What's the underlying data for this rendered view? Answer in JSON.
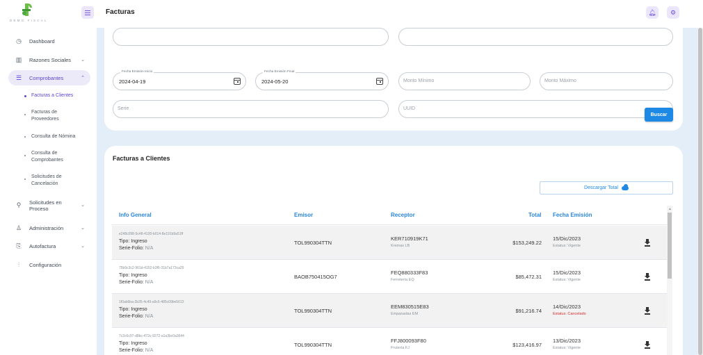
{
  "brand": {
    "wordmark": "DEMO FISCAL"
  },
  "header": {
    "title": "Facturas"
  },
  "sidebar": {
    "items": [
      {
        "label": "Dashboard",
        "icon": "dashboard-icon"
      },
      {
        "label": "Razones Sociales",
        "icon": "building-icon"
      },
      {
        "label": "Comprobantes",
        "icon": "list-icon"
      },
      {
        "label": "Solicitudes en Proceso",
        "icon": "search-icon"
      },
      {
        "label": "Administración",
        "icon": "users-icon"
      },
      {
        "label": "Autofactura",
        "icon": "invoice-icon"
      },
      {
        "label": "Configuración",
        "icon": "sliders-icon"
      }
    ],
    "subitems": [
      {
        "label": "Facturas a Clientes"
      },
      {
        "label": "Facturas de Proveedores"
      },
      {
        "label": "Consulta de Nómina"
      },
      {
        "label": "Consulta de Comprobantes"
      },
      {
        "label": "Solicitudes de Cancelación"
      }
    ]
  },
  "filters": {
    "fecha_inicio": {
      "label": "Fecha Emisión Inicio",
      "value": "2024-04-19"
    },
    "fecha_final": {
      "label": "Fecha Emisión Final",
      "value": "2024-05-20"
    },
    "monto_minimo": {
      "placeholder": "Monto Mínimo"
    },
    "monto_maximo": {
      "placeholder": "Monto Máximo"
    },
    "serie": {
      "placeholder": "Serie"
    },
    "uuid": {
      "placeholder": "UUID"
    },
    "buscar_label": "Buscar"
  },
  "table": {
    "title": "Facturas a Clientes",
    "download_label": "Descargar Total",
    "headers": {
      "info": "Info General",
      "emisor": "Emisor",
      "receptor": "Receptor",
      "total": "Total",
      "fecha": "Fecha Emisión"
    },
    "rows": [
      {
        "uuid": "e248c098-5c48-4100-b014-8e191b9a51ff",
        "tipo": "Tipo: Ingreso",
        "serie_label": "Serie-Folio:",
        "serie_value": "N/A",
        "emisor": "TOL990304TTN",
        "rfc": "KER710919K71",
        "rname": "Kremas LB",
        "total": "$153,249.22",
        "fecha": "15/Dic/2023",
        "estatus": "Estatus: Vigente",
        "status_color": "#8c939a"
      },
      {
        "uuid": "75b5c3c2-961d-4152-b3f6-31b7a173ca29",
        "tipo": "Tipo: Ingreso",
        "serie_label": "Serie-Folio:",
        "serie_value": "N/A",
        "emisor": "BAOB750415OG7",
        "rfc": "FEQ880333F83",
        "rname": "Ferretería EQ",
        "total": "$85,472.31",
        "fecha": "15/Dic/2023",
        "estatus": "Estatus: Vigente",
        "status_color": "#8c939a"
      },
      {
        "uuid": "1f0ab6ba-2b35-4c49-a9c6-485c09be5613",
        "tipo": "Tipo: Ingreso",
        "serie_label": "Serie-Folio:",
        "serie_value": "N/A",
        "emisor": "TOL990304TTN",
        "rfc": "EEM830515E83",
        "rname": "Empanadas EM",
        "total": "$91,216.74",
        "fecha": "14/Dic/2023",
        "estatus": "Estatus: Cancelado",
        "status_color": "#d32f2f"
      },
      {
        "uuid": "7c2c6c97-d8bc-472c-9272-a1a3bc0a3644",
        "tipo": "Tipo: Ingreso",
        "serie_label": "Serie-Folio:",
        "serie_value": "N/A",
        "emisor": "TOL990304TTN",
        "rfc": "FFJ800093F80",
        "rname": "Frutería FJ",
        "total": "$123,416.97",
        "fecha": "13/Dic/2023",
        "estatus": "Estatus: Vigente",
        "status_color": "#8c939a"
      }
    ]
  },
  "colors": {
    "accent": "#5b44d2",
    "link_blue": "#1e88e5",
    "brand_green": "#6cbe45",
    "background": "#e4eef9"
  }
}
